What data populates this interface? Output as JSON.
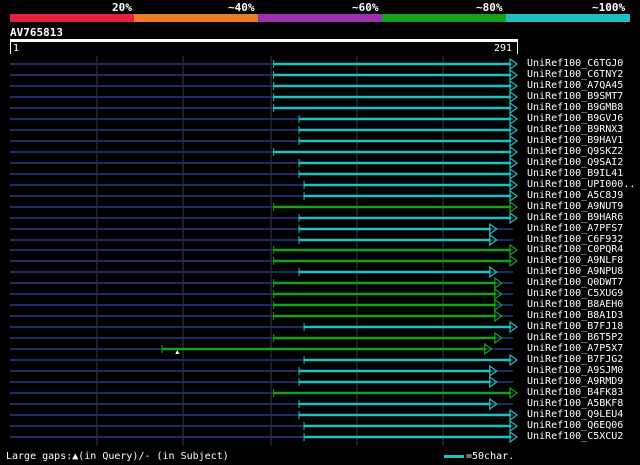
{
  "legend": {
    "labels": [
      "20%",
      "~40%",
      "~60%",
      "~80%",
      "~100%"
    ],
    "colors": [
      "#e8203c",
      "#e87d23",
      "#9b2fae",
      "#18a018",
      "#21c0c0"
    ]
  },
  "query": {
    "id": "AV765813",
    "start": "1",
    "end": "291"
  },
  "hits": [
    {
      "label": "UniRef100_C6TGJ0",
      "color": "cyan",
      "start_frac": 0.52
    },
    {
      "label": "UniRef100_C6TNY2",
      "color": "cyan",
      "start_frac": 0.52
    },
    {
      "label": "UniRef100_A7QA45",
      "color": "cyan",
      "start_frac": 0.52
    },
    {
      "label": "UniRef100_B9SMT7",
      "color": "cyan",
      "start_frac": 0.52
    },
    {
      "label": "UniRef100_B9GMB8",
      "color": "cyan",
      "start_frac": 0.52
    },
    {
      "label": "UniRef100_B9GVJ6",
      "color": "cyan",
      "start_frac": 0.57
    },
    {
      "label": "UniRef100_B9RNX3",
      "color": "cyan",
      "start_frac": 0.57
    },
    {
      "label": "UniRef100_B9HAV1",
      "color": "cyan",
      "start_frac": 0.57
    },
    {
      "label": "UniRef100_Q9SKZ2",
      "color": "cyan",
      "start_frac": 0.52
    },
    {
      "label": "UniRef100_Q9SAI2",
      "color": "cyan",
      "start_frac": 0.57
    },
    {
      "label": "UniRef100_B9IL41",
      "color": "cyan",
      "start_frac": 0.57
    },
    {
      "label": "UniRef100_UPI000..",
      "color": "cyan",
      "start_frac": 0.58
    },
    {
      "label": "UniRef100_A5C8J9",
      "color": "cyan",
      "start_frac": 0.58
    },
    {
      "label": "UniRef100_A9NUT9",
      "color": "green",
      "start_frac": 0.52
    },
    {
      "label": "UniRef100_B9HAR6",
      "color": "cyan",
      "start_frac": 0.57
    },
    {
      "label": "UniRef100_A7PFS7",
      "color": "cyan",
      "start_frac": 0.57,
      "end_frac": 0.96
    },
    {
      "label": "UniRef100_C6F932",
      "color": "cyan",
      "start_frac": 0.57,
      "end_frac": 0.96
    },
    {
      "label": "UniRef100_C0PQR4",
      "color": "green",
      "start_frac": 0.52
    },
    {
      "label": "UniRef100_A9NLF8",
      "color": "green",
      "start_frac": 0.52
    },
    {
      "label": "UniRef100_A9NPU8",
      "color": "cyan",
      "start_frac": 0.57,
      "end_frac": 0.96
    },
    {
      "label": "UniRef100_Q0DWT7",
      "color": "green",
      "start_frac": 0.52,
      "end_frac": 0.97
    },
    {
      "label": "UniRef100_C5XUG9",
      "color": "green",
      "start_frac": 0.52,
      "end_frac": 0.97
    },
    {
      "label": "UniRef100_B8AEH0",
      "color": "green",
      "start_frac": 0.52,
      "end_frac": 0.97
    },
    {
      "label": "UniRef100_B8A1D3",
      "color": "green",
      "start_frac": 0.52,
      "end_frac": 0.97
    },
    {
      "label": "UniRef100_B7FJ18",
      "color": "cyan",
      "start_frac": 0.58
    },
    {
      "label": "UniRef100_B6T5P2",
      "color": "green",
      "start_frac": 0.52,
      "end_frac": 0.97
    },
    {
      "label": "UniRef100_A7P5X7",
      "color": "green",
      "start_frac": 0.3,
      "end_frac": 0.95,
      "gap_frac": 0.33
    },
    {
      "label": "UniRef100_B7FJG2",
      "color": "cyan",
      "start_frac": 0.58
    },
    {
      "label": "UniRef100_A9SJM0",
      "color": "cyan",
      "start_frac": 0.57,
      "end_frac": 0.96
    },
    {
      "label": "UniRef100_A9RMD9",
      "color": "cyan",
      "start_frac": 0.57,
      "end_frac": 0.96
    },
    {
      "label": "UniRef100_B4FK83",
      "color": "green",
      "start_frac": 0.52
    },
    {
      "label": "UniRef100_A5BKF8",
      "color": "cyan",
      "start_frac": 0.57,
      "end_frac": 0.96
    },
    {
      "label": "UniRef100_Q9LEU4",
      "color": "cyan",
      "start_frac": 0.57
    },
    {
      "label": "UniRef100_Q6EQ06",
      "color": "cyan",
      "start_frac": 0.58
    },
    {
      "label": "UniRef100_C5XCU2",
      "color": "cyan",
      "start_frac": 0.58
    }
  ],
  "footer": {
    "gaps_text": "Large gaps:▲(in Query)/- (in Subject)",
    "scale_text": "=50char."
  }
}
